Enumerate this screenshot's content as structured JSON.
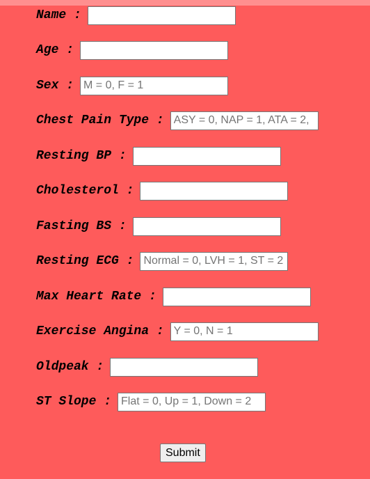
{
  "form": {
    "fields": [
      {
        "label": "Name :",
        "value": "",
        "placeholder": ""
      },
      {
        "label": "Age :",
        "value": "",
        "placeholder": ""
      },
      {
        "label": "Sex :",
        "value": "",
        "placeholder": "M = 0, F = 1"
      },
      {
        "label": "Chest Pain Type :",
        "value": "",
        "placeholder": "ASY = 0, NAP = 1, ATA = 2,"
      },
      {
        "label": "Resting BP :",
        "value": "",
        "placeholder": ""
      },
      {
        "label": "Cholesterol :",
        "value": "",
        "placeholder": ""
      },
      {
        "label": "Fasting BS :",
        "value": "",
        "placeholder": ""
      },
      {
        "label": "Resting ECG :",
        "value": "",
        "placeholder": "Normal = 0, LVH = 1, ST = 2"
      },
      {
        "label": "Max Heart Rate :",
        "value": "",
        "placeholder": ""
      },
      {
        "label": "Exercise Angina :",
        "value": "",
        "placeholder": "Y = 0, N = 1"
      },
      {
        "label": "Oldpeak :",
        "value": "",
        "placeholder": ""
      },
      {
        "label": "ST Slope :",
        "value": "",
        "placeholder": "Flat = 0, Up = 1, Down = 2"
      }
    ],
    "submit_label": "Submit"
  },
  "colors": {
    "background": "#fe5b5b",
    "top_strip": "#ff8f8f"
  }
}
